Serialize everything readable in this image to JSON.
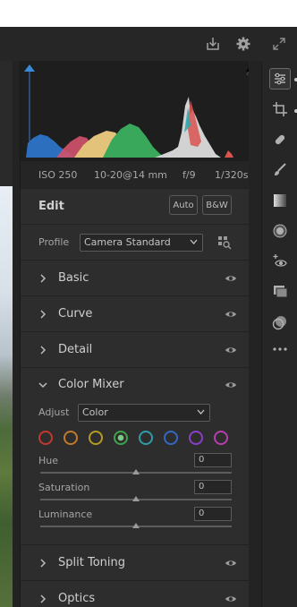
{
  "header": {
    "icons": [
      "export-icon",
      "gear-icon",
      "expand-icon"
    ]
  },
  "histogram": {
    "exif": {
      "iso": "ISO 250",
      "lens": "10-20@14 mm",
      "aperture": "f/9",
      "shutter": "1/320s"
    }
  },
  "edit": {
    "title": "Edit",
    "auto_label": "Auto",
    "bw_label": "B&W"
  },
  "profile": {
    "label": "Profile",
    "value": "Camera Standard"
  },
  "sections": {
    "basic": "Basic",
    "curve": "Curve",
    "detail": "Detail",
    "color_mixer": "Color Mixer",
    "split_toning": "Split Toning",
    "optics": "Optics"
  },
  "color_mixer": {
    "adjust_label": "Adjust",
    "adjust_value": "Color",
    "swatches": [
      "#c0392b",
      "#c07a2b",
      "#b59a26",
      "#3fa34d",
      "#2f9ca8",
      "#3467c4",
      "#8b3fc4",
      "#b63fb0"
    ],
    "selected_swatch": 3,
    "sliders": [
      {
        "label": "Hue",
        "value": "0"
      },
      {
        "label": "Saturation",
        "value": "0"
      },
      {
        "label": "Luminance",
        "value": "0"
      }
    ]
  },
  "toolbar": {
    "tools": [
      "edit-sliders-icon",
      "crop-icon",
      "healing-icon",
      "brush-icon",
      "gradient-icon",
      "radial-icon",
      "redeye-icon",
      "presets-icon",
      "snapshots-icon",
      "more-icon"
    ]
  }
}
